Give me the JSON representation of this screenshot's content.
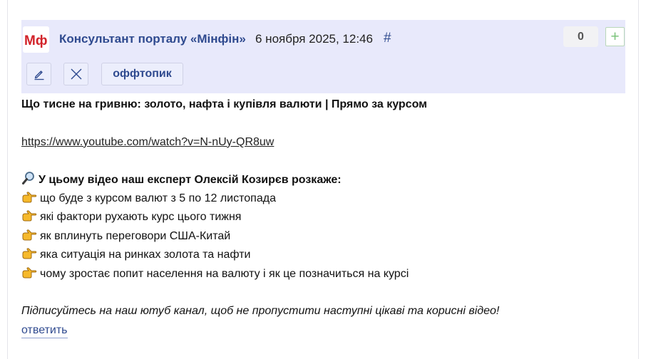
{
  "comment": {
    "logo_text": "Мф",
    "author": "Консультант порталу «Мінфін»",
    "date": "6 ноября 2025, 12:46",
    "permalink": "#",
    "score": "0",
    "vote_up_label": "+",
    "tag_label": "оффтопик",
    "title": "Що тисне на гривню: золото, нафта і купівля валюти | Прямо за курсом",
    "link": "https://www.youtube.com/watch?v=N-nUy-QR8uw",
    "intro": "У цьому відео наш експерт Олексій Козирєв розкаже:",
    "bullets": [
      "що буде з курсом валют з 5 по 12 листопада",
      "які фактори рухають курс цього тижня",
      "як вплинуть переговори США-Китай",
      "яка ситуація на ринках золота та нафти",
      "чому зростає попит населення на валюту і як це позначиться на курсі"
    ],
    "outro": "Підписуйтесь на наш ютуб канал, щоб не пропустити наступні цікаві та корисні відео!",
    "reply_label": "ответить"
  },
  "icons": {
    "edit": "pencil-icon",
    "delete": "close-icon",
    "intro": "magnifier-emoji",
    "bullet": "pointing-hand-emoji"
  },
  "colors": {
    "header_bg": "#e8e9fb",
    "link_blue": "#2f4a8f",
    "logo_red": "#d2232a",
    "vote_green": "#7cc47c"
  }
}
